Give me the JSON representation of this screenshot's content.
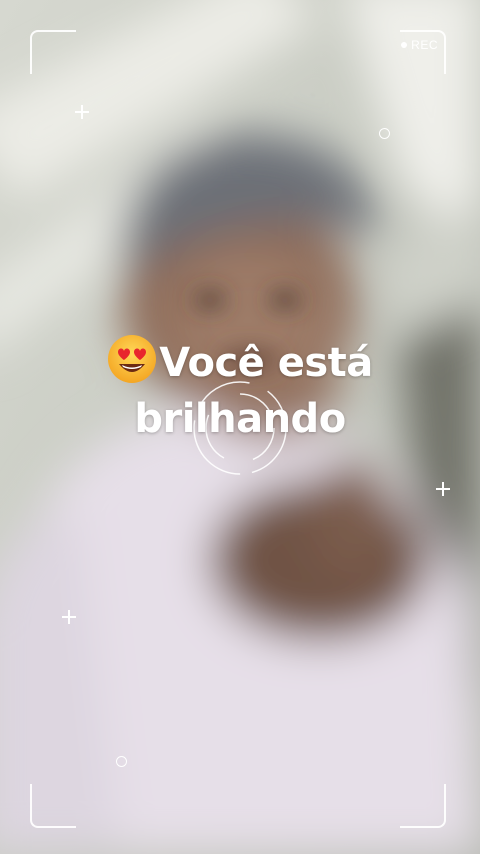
{
  "recording": {
    "label": "REC"
  },
  "caption": {
    "emoji": "smiling-face-with-heart-eyes",
    "line1": "Você está",
    "line2": "brilhando"
  },
  "colors": {
    "overlay": "#ffffff",
    "shirt": "#e8e0ea",
    "cap": "#6e7278",
    "skin": "#8a6a58",
    "background": "#d9dad4"
  }
}
